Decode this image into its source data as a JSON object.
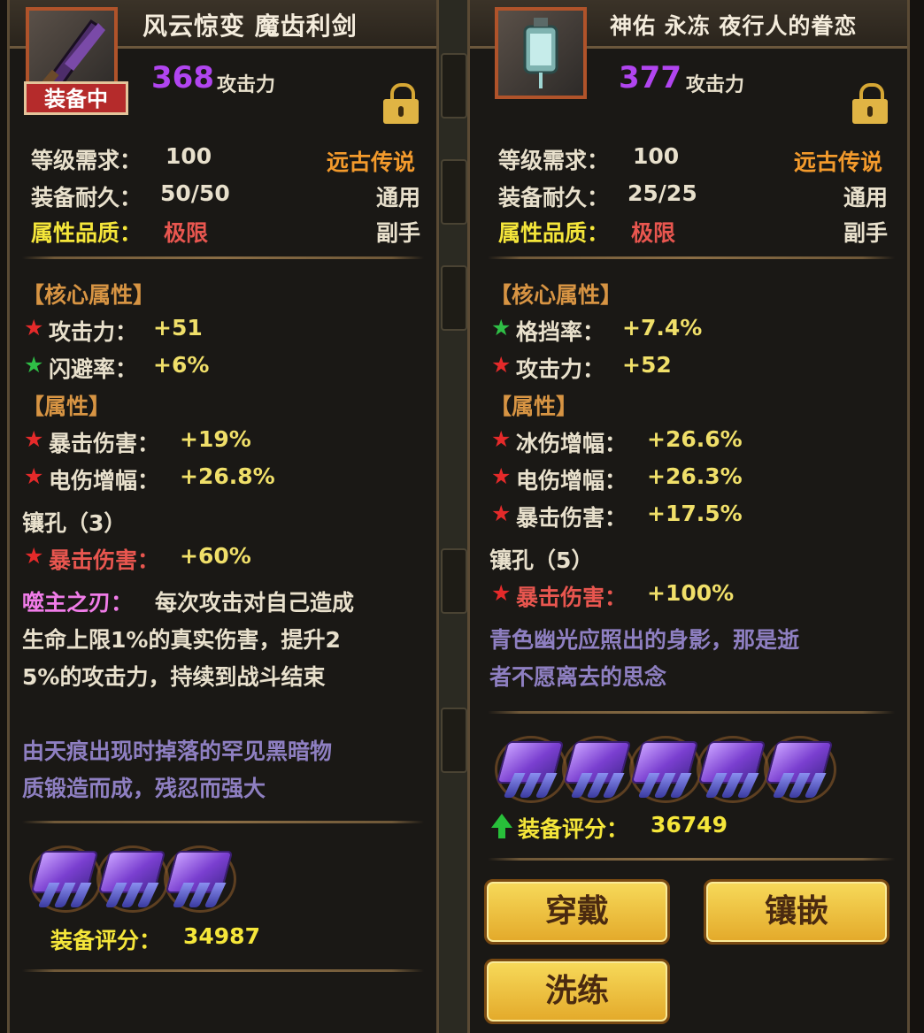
{
  "left_panel": {
    "title": "风云惊变 魔齿利剑",
    "equipped_badge": "装备中",
    "attack_value": "368",
    "attack_label": "攻击力",
    "level_req": "等级需求：",
    "level_value": "100",
    "rarity": "远古传说",
    "durability_label": "装备耐久：",
    "durability_value": "50/50",
    "class": "通用",
    "quality_label": "属性品质：",
    "quality_value": "极限",
    "slot": "副手",
    "core_header": "【核心属性】",
    "core_stats": [
      {
        "star": "★",
        "star_color": "#e52a2a",
        "name": "攻击力：",
        "value": "+51"
      },
      {
        "star": "★",
        "star_color": "#2fbf46",
        "name": "闪避率：",
        "value": "+6%"
      }
    ],
    "attr_header": "【属性】",
    "attrs": [
      {
        "star": "★",
        "name": "暴击伤害：",
        "value": "+19%"
      },
      {
        "star": "★",
        "name": "电伤增幅：",
        "value": "+26.8%"
      }
    ],
    "socket_label": "镶孔（3）",
    "socket_stat": {
      "star": "★",
      "name": "暴击伤害：",
      "value": "+60%"
    },
    "skill_name": "噬主之刃：",
    "skill_line1": "每次攻击对自己造成",
    "skill_line2": "生命上限1%的真实伤害，提升2",
    "skill_line3": "5%的攻击力，持续到战斗结束",
    "lore_line1": "由天痕出现时掉落的罕见黑暗物",
    "lore_line2": "质锻造而成，残忍而强大",
    "gem_count": 3,
    "score_label": "装备评分：",
    "score_value": "34987"
  },
  "right_panel": {
    "title": "神佑 永冻 夜行人的眷恋",
    "attack_value": "377",
    "attack_label": "攻击力",
    "level_req": "等级需求：",
    "level_value": "100",
    "rarity": "远古传说",
    "durability_label": "装备耐久：",
    "durability_value": "25/25",
    "class": "通用",
    "quality_label": "属性品质：",
    "quality_value": "极限",
    "slot": "副手",
    "core_header": "【核心属性】",
    "core_stats": [
      {
        "star": "★",
        "star_color": "#2fbf46",
        "name": "格挡率：",
        "value": "+7.4%"
      },
      {
        "star": "★",
        "star_color": "#e52a2a",
        "name": "攻击力：",
        "value": "+52"
      }
    ],
    "attr_header": "【属性】",
    "attrs": [
      {
        "star": "★",
        "name": "冰伤增幅：",
        "value": "+26.6%"
      },
      {
        "star": "★",
        "name": "电伤增幅：",
        "value": "+26.3%"
      },
      {
        "star": "★",
        "name": "暴击伤害：",
        "value": "+17.5%"
      }
    ],
    "socket_label": "镶孔（5）",
    "socket_stat": {
      "star": "★",
      "name": "暴击伤害：",
      "value": "+100%"
    },
    "lore_line1": "青色幽光应照出的身影，那是逝",
    "lore_line2": "者不愿离去的思念",
    "gem_count": 5,
    "score_label": "装备评分：",
    "score_value": "36749",
    "buttons": {
      "wear": "穿戴",
      "inlay": "镶嵌",
      "refine": "洗练"
    }
  },
  "icons": {
    "lock": "lock-icon",
    "gem": "gem-icon",
    "arrow": "green-up-arrow-icon",
    "sword": "sword-item-icon",
    "lantern": "lantern-item-icon"
  }
}
